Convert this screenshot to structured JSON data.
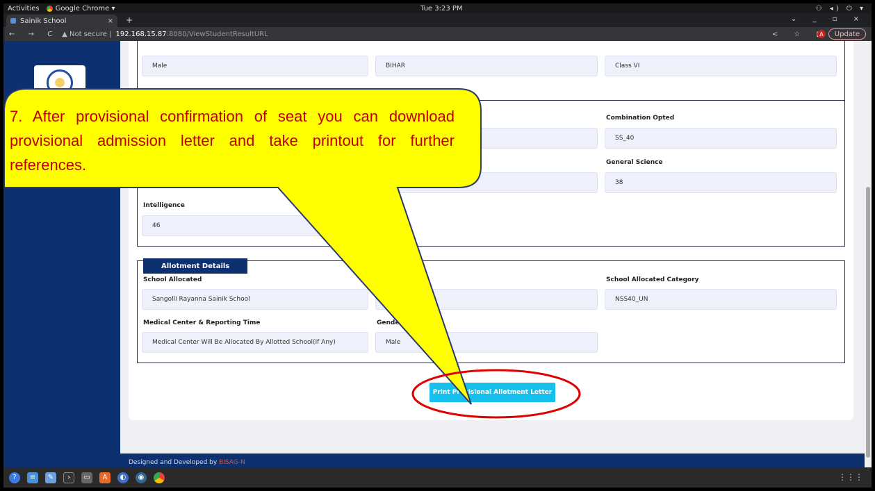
{
  "system_bar": {
    "activities": "Activities",
    "app_name": "Google Chrome ▾",
    "clock": "Tue  3:23 PM",
    "tray": "⚇ ◂) ⏻ ▾"
  },
  "browser": {
    "tab_title": "Sainik School",
    "tab_close": "×",
    "new_tab": "+",
    "window_controls": "⌄ _ ▫ ×",
    "nav_icons": "← → C",
    "not_secure": "▲ Not secure |",
    "url_host": "192.168.15.87",
    "url_path": ":8080/ViewStudentResultURL",
    "right_icons": "< ☆ ◧",
    "avatar": "A",
    "update_label": "Update"
  },
  "personal": {
    "gender_value": "Male",
    "state_value": "BIHAR",
    "class_value": "Class VI"
  },
  "marks": {
    "combination_label": "Combination Opted",
    "combination_value": "SS_40",
    "general_science_label": "General Science",
    "general_science_value": "38",
    "intelligence_label": "Intelligence",
    "intelligence_value": "46"
  },
  "allotment": {
    "section_title": "Allotment Details",
    "school_label": "School Allocated",
    "school_value": "Sangolli Rayanna Sainik School",
    "category_label": "School Allocated Category",
    "category_value": "NSS40_UN",
    "medical_label": "Medical Center & Reporting Time",
    "medical_value": "Medical Center Will Be Allocated By Allotted School(If Any)",
    "gender_label": "Gender A",
    "gender_value": "Male"
  },
  "actions": {
    "print_label": "Print Provisional Allotment Letter"
  },
  "footer": {
    "prefix": "Designed and Developed by ",
    "brand": "BISAG-N"
  },
  "callout": {
    "text": "7. After provisional confirmation of seat you can download provisional admission letter and take printout for further references."
  },
  "dock": {
    "icons": [
      "help-icon",
      "text-editor-icon",
      "notes-icon",
      "terminal-icon",
      "files-icon",
      "software-icon",
      "browser-icon",
      "database-icon",
      "chrome-icon"
    ],
    "app_grid": "⋮⋮⋮"
  },
  "colors": {
    "sidebar": "#0d3070",
    "button": "#17c0ec",
    "callout_fill": "#ffff00",
    "callout_text": "#c00000",
    "highlight_ring": "#e00000"
  }
}
